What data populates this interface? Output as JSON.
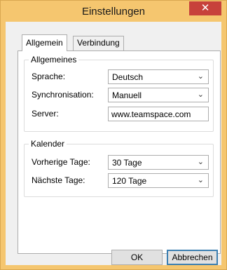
{
  "window": {
    "title": "Einstellungen",
    "close_label": "✕"
  },
  "tabs": [
    {
      "label": "Allgemein",
      "active": true
    },
    {
      "label": "Verbindung",
      "active": false
    }
  ],
  "general": {
    "legend": "Allgemeines",
    "language": {
      "label": "Sprache:",
      "value": "Deutsch"
    },
    "sync": {
      "label": "Synchronisation:",
      "value": "Manuell"
    },
    "server": {
      "label": "Server:",
      "value": "www.teamspace.com"
    }
  },
  "calendar": {
    "legend": "Kalender",
    "previous_days": {
      "label": "Vorherige Tage:",
      "value": "30 Tage"
    },
    "next_days": {
      "label": "Nächste Tage:",
      "value": "120 Tage"
    }
  },
  "buttons": {
    "ok": "OK",
    "cancel": "Abbrechen"
  },
  "icons": {
    "dropdown": "chevron-down-icon",
    "close": "close-icon"
  },
  "colors": {
    "window_frame": "#f5c66f",
    "close_button": "#c7413b",
    "default_button_border": "#3c7fb1"
  }
}
